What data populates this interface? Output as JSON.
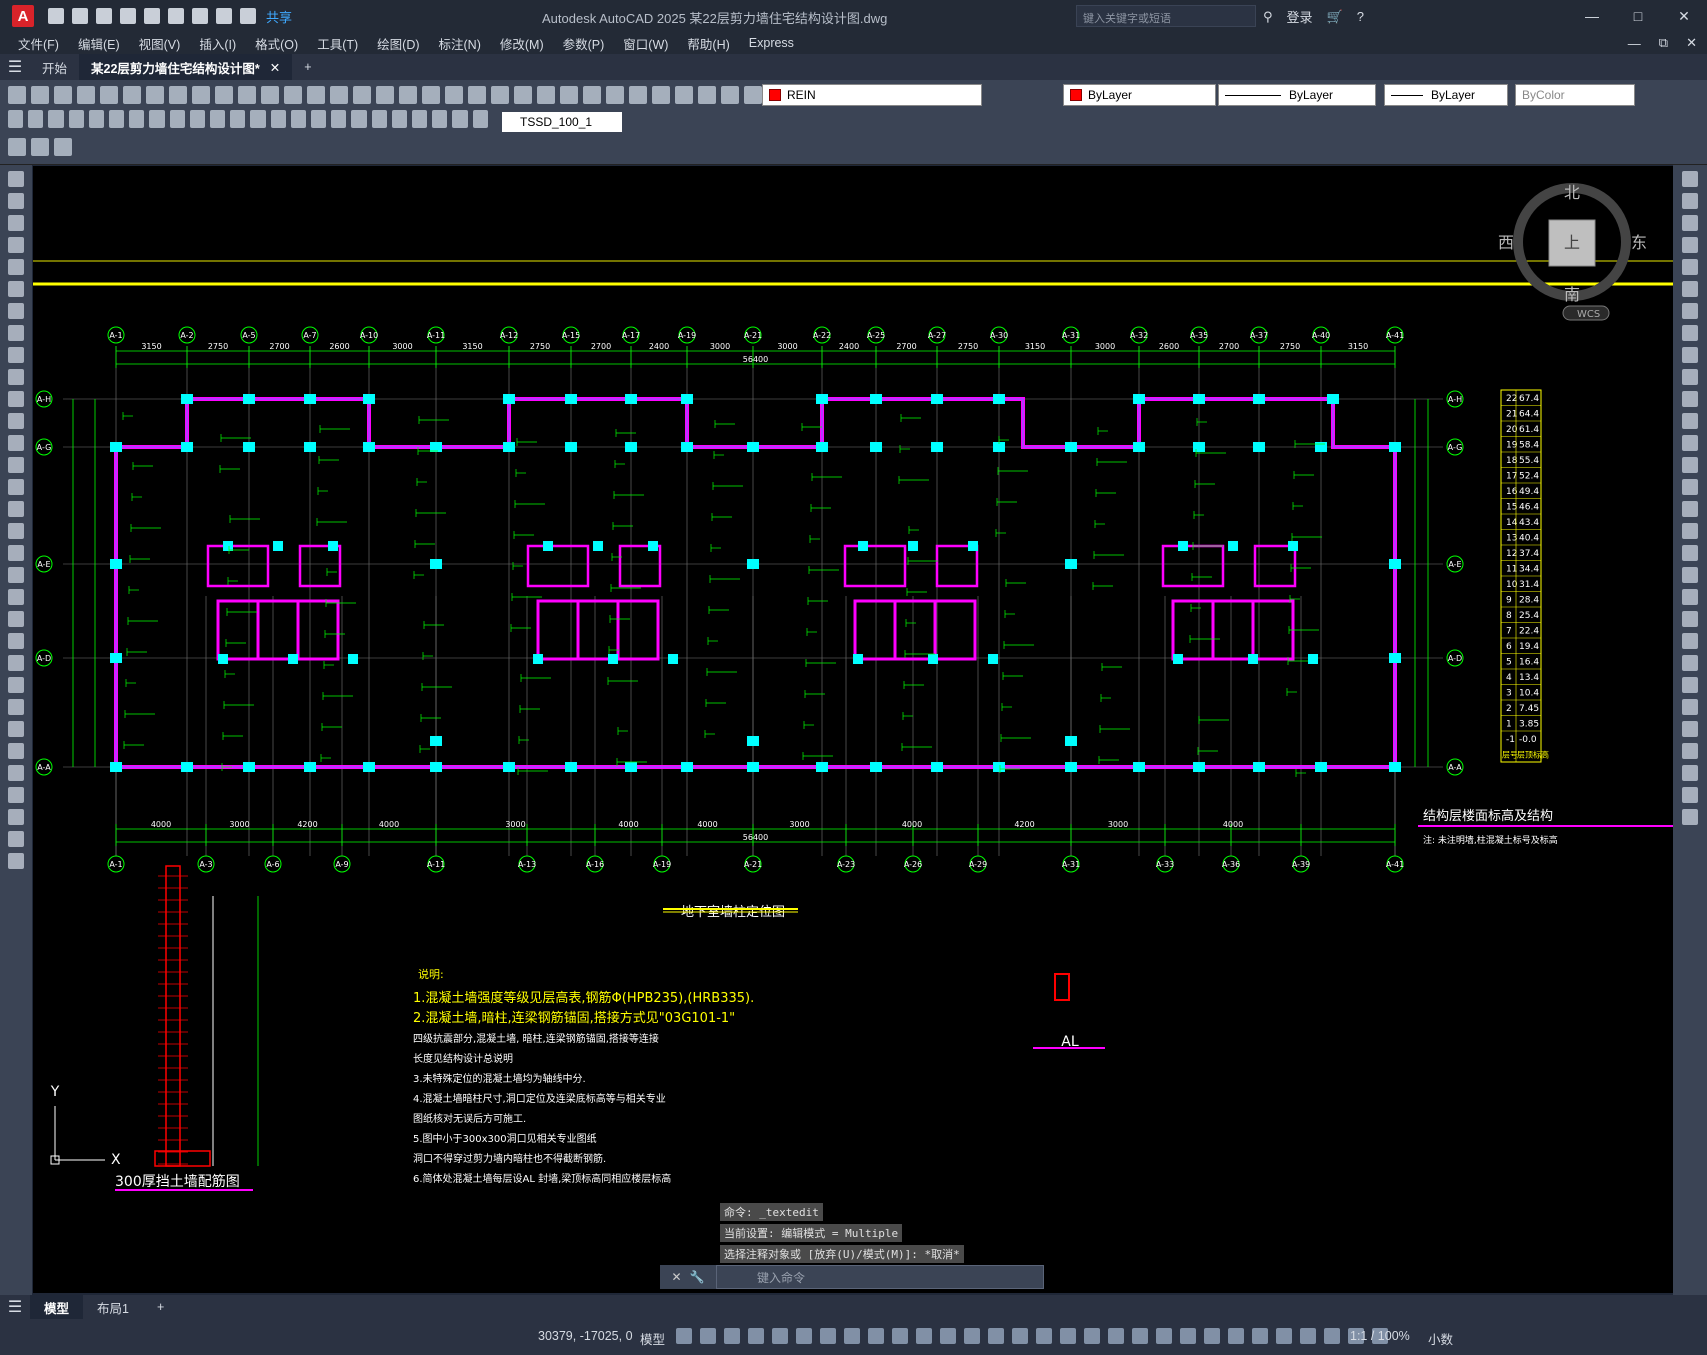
{
  "titlebar": {
    "app_logo": "A",
    "share_label": "共享",
    "window_title": "Autodesk AutoCAD 2025    某22层剪力墙住宅结构设计图.dwg",
    "search_placeholder": "键入关键字或短语",
    "login_label": "登录"
  },
  "menubar": {
    "items": [
      "文件(F)",
      "编辑(E)",
      "视图(V)",
      "插入(I)",
      "格式(O)",
      "工具(T)",
      "绘图(D)",
      "标注(N)",
      "修改(M)",
      "参数(P)",
      "窗口(W)",
      "帮助(H)",
      "Express"
    ]
  },
  "tabs": {
    "start": "开始",
    "document": "某22层剪力墙住宅结构设计图*"
  },
  "ribbon": {
    "layer_name": "REIN",
    "color_value": "ByLayer",
    "linetype_value": "ByLayer",
    "lineweight_value": "ByLayer",
    "plotstyle_value": "ByColor",
    "dimstyle_value": "TSSD_100_1",
    "layer_color": "#ff0000"
  },
  "drawing": {
    "main_title": "地下室墙柱定位图",
    "total_dimension": "56400",
    "axis_top": [
      "A-1",
      "A-2",
      "A-5",
      "A-7",
      "A-10",
      "A-11",
      "A-12",
      "A-15",
      "A-17",
      "A-19",
      "A-21",
      "A-22",
      "A-25",
      "A-27",
      "A-30",
      "A-31",
      "A-32",
      "A-35",
      "A-37",
      "A-40",
      "A-41"
    ],
    "axis_bottom": [
      "A-1",
      "A-3",
      "A-6",
      "A-9",
      "A-11",
      "A-13",
      "A-16",
      "A-19",
      "A-21",
      "A-23",
      "A-26",
      "A-29",
      "A-31",
      "A-33",
      "A-36",
      "A-39",
      "A-41"
    ],
    "axis_left": [
      "A-H",
      "A-G",
      "A-E",
      "A-D",
      "A-A"
    ],
    "top_dims": [
      "3150",
      "2750",
      "2700",
      "2600",
      "3000",
      "3150",
      "2750",
      "2700",
      "2400",
      "3000",
      "3000",
      "2400",
      "2700",
      "2750",
      "3150",
      "3000",
      "2600",
      "2700",
      "2750",
      "3150"
    ],
    "bottom_dims": [
      "4000",
      "3000",
      "4200",
      "4000",
      "3000",
      "4000",
      "4000",
      "3000",
      "4000",
      "4200",
      "3000",
      "4000"
    ],
    "notes_title": "说明:",
    "notes": [
      "1.混凝土墙强度等级见层高表,钢筋Φ(HPB235),(HRB335).",
      "2.混凝土墙,暗柱,连梁钢筋锚固,搭接方式见\"03G101-1\"",
      "   四级抗震部分,混凝土墙,            暗柱,连梁钢筋锚固,搭接等连接",
      "   长度见结构设计总说明",
      "3.未特殊定位的混凝土墙均为轴线中分.",
      "4.混凝土墙暗柱尺寸,洞口定位及连梁底标高等与相关专业",
      "   图纸核对无误后方可施工.",
      "5.图中小于300x300洞口见相关专业图纸",
      "   洞口不得穿过剪力墙内暗柱也不得截断钢筋.",
      "6.简体处混凝土墙每层设AL 封墙,梁顶标高同相应楼层标高"
    ],
    "retaining_wall_title": "300厚挡土墙配筋图",
    "beam_label": "AL",
    "floor_table_title": "结构层楼面标高及结构",
    "floor_table_note": "注: 未注明墙,柱混凝土标号及标高",
    "floor_levels": [
      {
        "floor": "22",
        "elev": "67.4"
      },
      {
        "floor": "21",
        "elev": "64.4"
      },
      {
        "floor": "20",
        "elev": "61.4"
      },
      {
        "floor": "19",
        "elev": "58.4"
      },
      {
        "floor": "18",
        "elev": "55.4"
      },
      {
        "floor": "17",
        "elev": "52.4"
      },
      {
        "floor": "16",
        "elev": "49.4"
      },
      {
        "floor": "15",
        "elev": "46.4"
      },
      {
        "floor": "14",
        "elev": "43.4"
      },
      {
        "floor": "13",
        "elev": "40.4"
      },
      {
        "floor": "12",
        "elev": "37.4"
      },
      {
        "floor": "11",
        "elev": "34.4"
      },
      {
        "floor": "10",
        "elev": "31.4"
      },
      {
        "floor": "9",
        "elev": "28.4"
      },
      {
        "floor": "8",
        "elev": "25.4"
      },
      {
        "floor": "7",
        "elev": "22.4"
      },
      {
        "floor": "6",
        "elev": "19.4"
      },
      {
        "floor": "5",
        "elev": "16.4"
      },
      {
        "floor": "4",
        "elev": "13.4"
      },
      {
        "floor": "3",
        "elev": "10.4"
      },
      {
        "floor": "2",
        "elev": "7.45"
      },
      {
        "floor": "1",
        "elev": "3.85"
      },
      {
        "floor": "-1",
        "elev": "-0.0"
      }
    ],
    "floor_table_footer": [
      "层号",
      "层顶标高"
    ],
    "navcube": {
      "north": "北",
      "south": "南",
      "east": "东",
      "west": "西",
      "top": "上",
      "wcs": "WCS"
    },
    "ucs_x": "X",
    "ucs_y": "Y"
  },
  "command": {
    "history": [
      "命令: _textedit",
      "当前设置: 编辑模式 = Multiple",
      "选择注释对象或 [放弃(U)/模式(M)]: *取消*"
    ],
    "input_placeholder": "键入命令"
  },
  "layouts": {
    "model": "模型",
    "layout1": "布局1"
  },
  "status": {
    "coordinates": "30379, -17025, 0",
    "space": "模型",
    "scale": "1:1 / 100%",
    "units": "小数"
  }
}
